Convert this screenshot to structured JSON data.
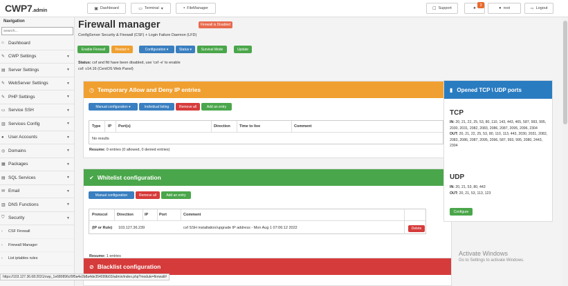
{
  "header": {
    "logo": "CWP7",
    "logo_suffix": ".admin",
    "dashboard": "Dashboard",
    "terminal": "Terminal",
    "filemanager": "FileManager",
    "support": "Support",
    "notif_count": "3",
    "user": "root",
    "logout": "Logout"
  },
  "sidebar": {
    "heading": "Navigation",
    "search_placeholder": "search...",
    "items": [
      {
        "label": "Dashboard"
      },
      {
        "label": "CWP Settings"
      },
      {
        "label": "Server Settings"
      },
      {
        "label": "WebServer Settings"
      },
      {
        "label": "PHP Settings"
      },
      {
        "label": "Service SSH"
      },
      {
        "label": "Services Config"
      },
      {
        "label": "User Accounts"
      },
      {
        "label": "Domains"
      },
      {
        "label": "Packages"
      },
      {
        "label": "SQL Services"
      },
      {
        "label": "Email"
      },
      {
        "label": "DNS Functions"
      },
      {
        "label": "Security"
      }
    ],
    "subitems": [
      {
        "label": "CSF Firewall"
      },
      {
        "label": "Firewall Manager"
      },
      {
        "label": "List iptables rules"
      }
    ]
  },
  "main": {
    "title": "Firewall manager",
    "disabled_tag": "Firewall is Disabled",
    "subtitle": "ConfigServer Security & Firewall (CSF) + Login Failure Daemon (LFD)",
    "buttons": {
      "enable": "Enable Firewall",
      "restart": "Restart ▾",
      "configuration": "Configuration ▾",
      "status": "Status ▾",
      "survival": "Survival Mode",
      "update": "Update"
    },
    "status_label": "Status:",
    "status_text": "csf and lfd have been disabled, use 'csf -e' to enable",
    "version": "csf: v14.16 (CentOS Web Panel)"
  },
  "temp_panel": {
    "title": "Temporary Allow and Deny IP entries",
    "buttons": {
      "manual": "Manual configuration ▾",
      "individual": "Individual listing",
      "remove": "Remove all",
      "add": "Add an entry"
    },
    "columns": [
      "Type",
      "IP",
      "Port(s)",
      "Direction",
      "Time to live",
      "Comment"
    ],
    "empty": "No results",
    "resume_label": "Resume:",
    "resume_text": "0 entries (0 allowed, 0 denied entries)"
  },
  "white_panel": {
    "title": "Whitelist configuration",
    "buttons": {
      "manual": "Manual configuration",
      "remove": "Remove all",
      "add": "Add an entry"
    },
    "columns": [
      "Protocol",
      "Direction",
      "IP",
      "Port",
      "Comment"
    ],
    "row": {
      "protocol": "(IP or Rule)",
      "ip": "103.127.36.239",
      "comment": "csf SSH installation/upgrade IP address - Mon Aug 1 07:06:12 2022",
      "delete": "Delete"
    },
    "resume_label": "Resume:",
    "resume_text": "1 entries"
  },
  "black_panel": {
    "title": "Blacklist configuration"
  },
  "ports_panel": {
    "title": "Opened TCP \\ UDP ports",
    "tcp": "TCP",
    "tcp_in_label": "IN:",
    "tcp_in": "20, 21, 22, 25, 53, 80, 110, 143, 443, 465, 587, 993, 995, 2030, 2031, 2082, 2083, 2086, 2087, 2095, 2096, 2304",
    "tcp_out_label": "OUT:",
    "tcp_out": "20, 21, 22, 25, 53, 80, 110, 113, 443, 2030, 2031, 2082, 2083, 2086, 2087, 2095, 2096, 587, 993, 995, 2080, 2443, 2304",
    "udp": "UDP",
    "udp_in_label": "IN:",
    "udp_in": "20, 21, 53, 80, 443",
    "udp_out_label": "OUT:",
    "udp_out": "20, 21, 53, 113, 123",
    "configure": "Configure"
  },
  "statusbar": {
    "url": "https://103.127.36.68:2031/cwp_1e680896cf9f5a4e2b8a4de354099b03/admin/index.php?module=firewall#"
  },
  "watermark": {
    "line1": "Activate Windows",
    "line2": "Go to Settings to activate Windows."
  },
  "colors": {
    "orange": "#f0a030",
    "green": "#4aa64a",
    "red": "#d63b3b",
    "blue": "#2a7cc1"
  }
}
